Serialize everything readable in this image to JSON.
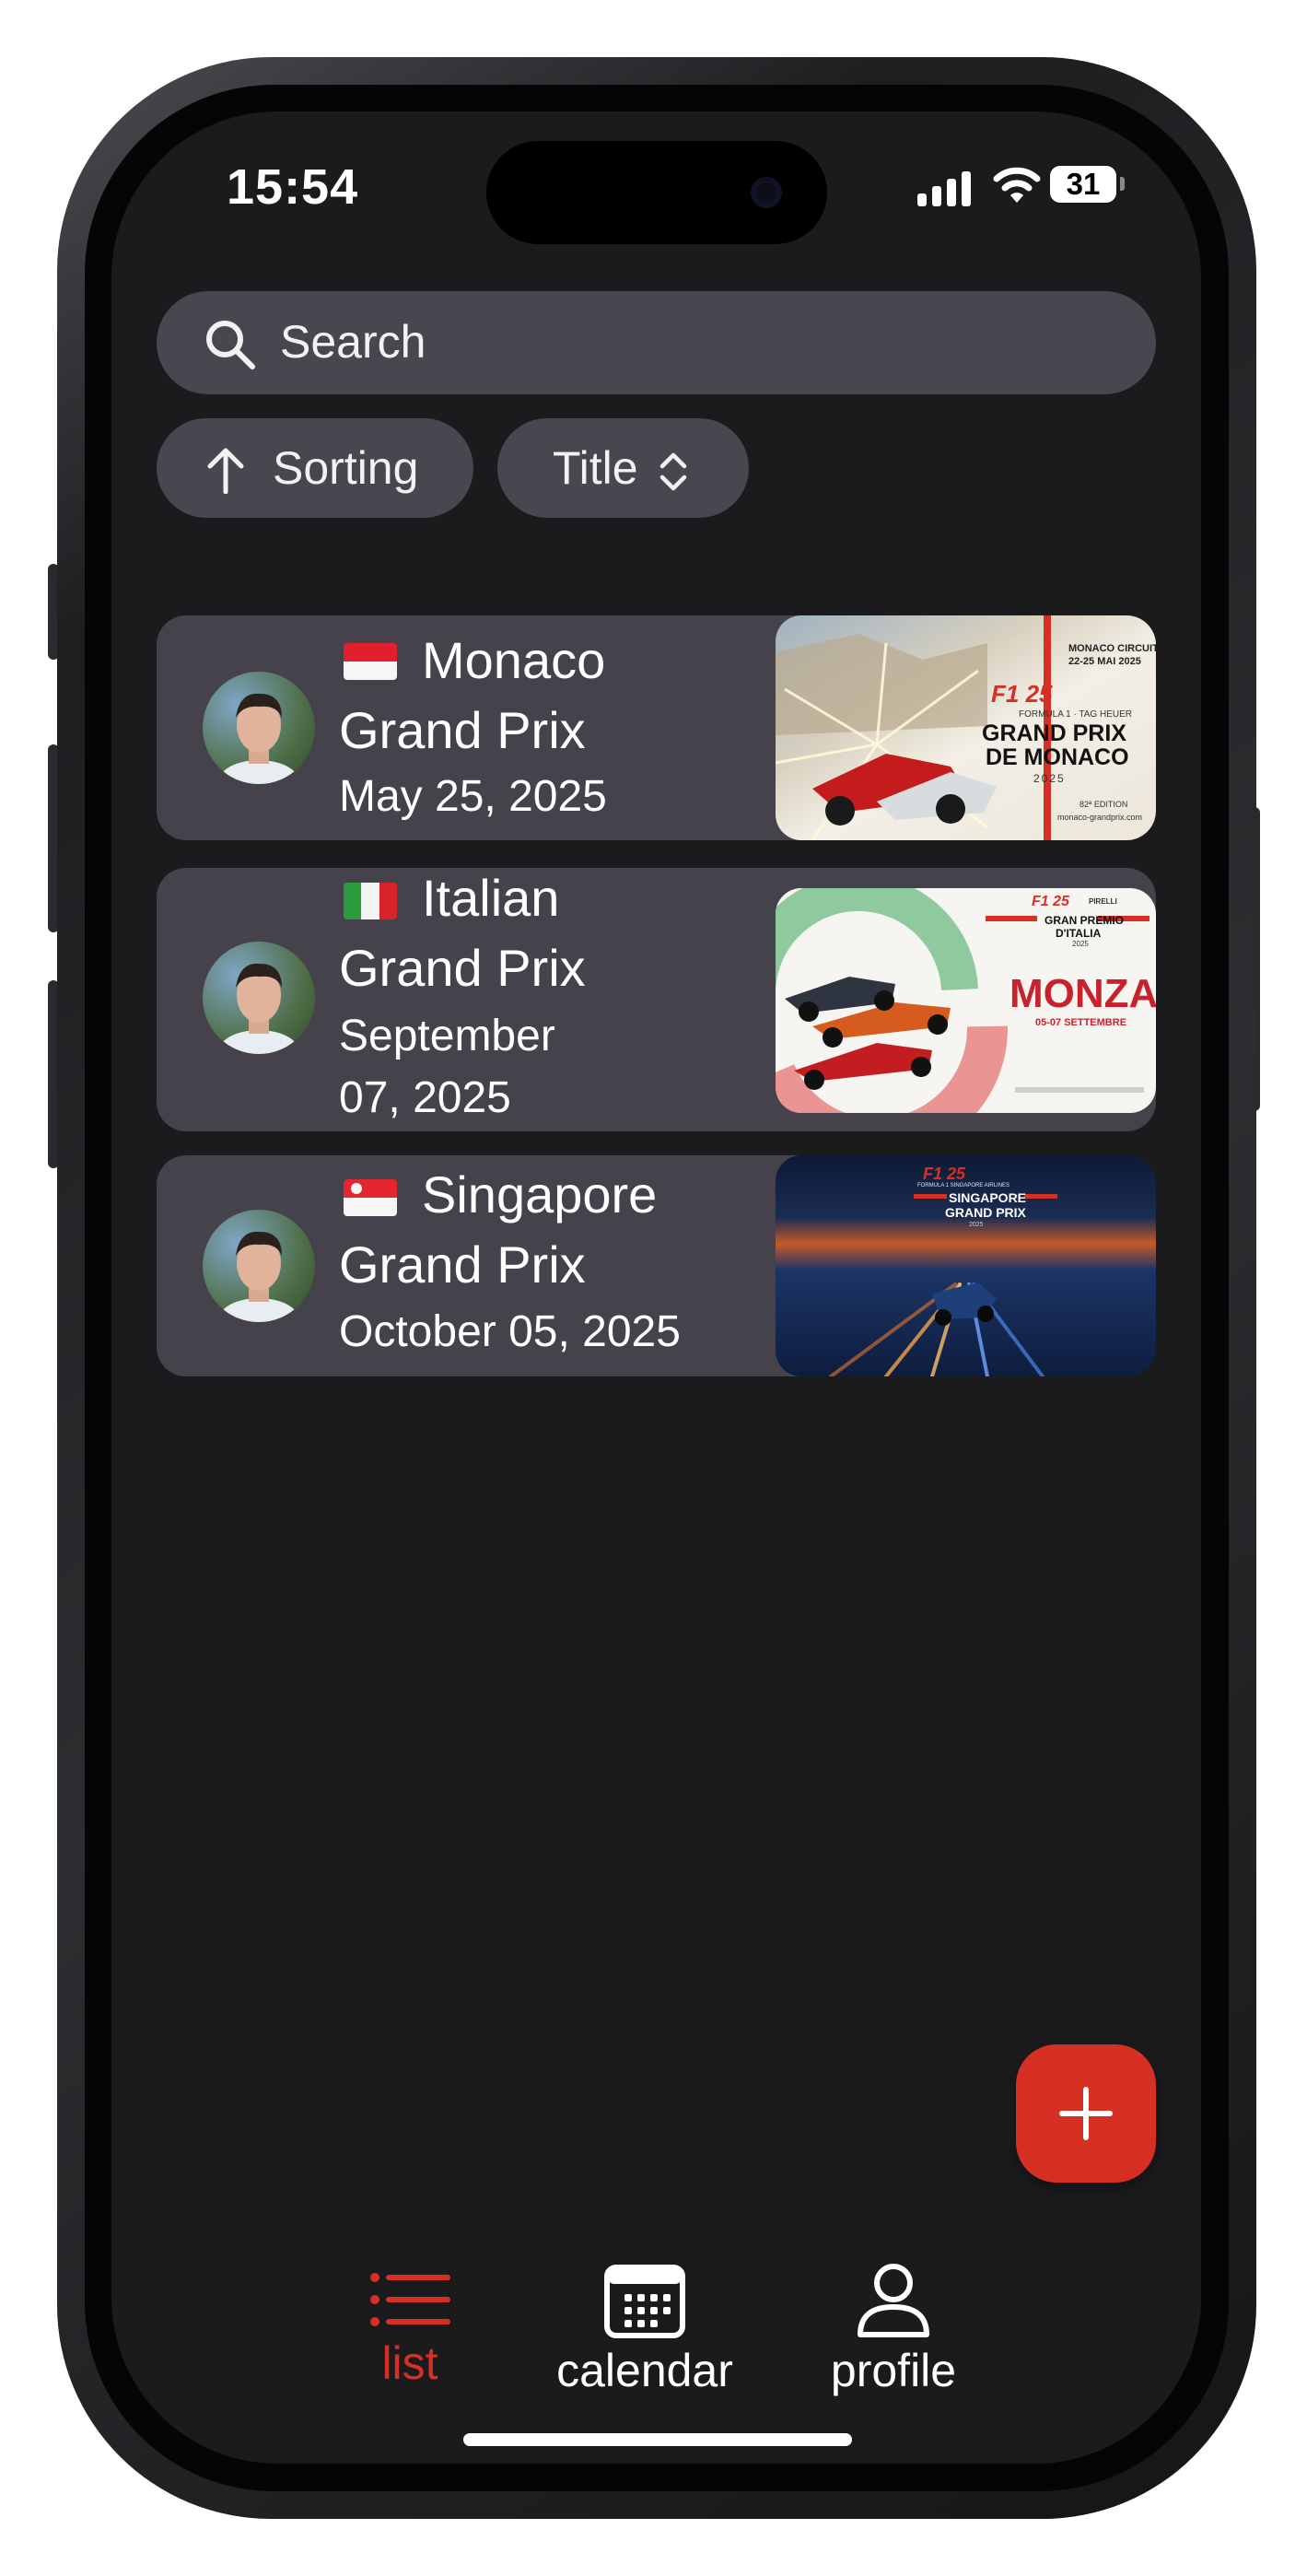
{
  "status_bar": {
    "time": "15:54",
    "battery_level": "31"
  },
  "search": {
    "placeholder": "Search"
  },
  "filters": {
    "sorting_label": "Sorting",
    "title_label": "Title"
  },
  "events": [
    {
      "flag": "Monaco",
      "title_line1": "Monaco",
      "title_line2": "Grand Prix",
      "date": "May 25, 2025",
      "poster": {
        "circuit": "MONACO CIRCUIT",
        "dates": "22-25 MAI 2025",
        "f1_year": "F1 25",
        "sponsor": "FORMULA 1 · TAG HEUER",
        "name_line1": "GRAND PRIX",
        "name_line2": "DE MONACO",
        "year": "2025",
        "edition": "82ª EDITION",
        "website": "monaco-grandprix.com"
      }
    },
    {
      "flag": "Italy",
      "title_line1": "Italian",
      "title_line2": "Grand Prix",
      "date_line1": "September",
      "date_line2": "07, 2025",
      "poster": {
        "f1_year": "F1 25",
        "sponsor": "PIRELLI",
        "name_line1": "GRAN PREMIO",
        "name_line2": "D'ITALIA",
        "year": "2025",
        "city": "MONZA",
        "dates": "05-07 SETTEMBRE"
      }
    },
    {
      "flag": "Singapore",
      "title_line1": "Singapore",
      "title_line2": "Grand Prix",
      "date": "October 05, 2025",
      "poster": {
        "f1_year": "F1 25",
        "sponsor": "FORMULA 1 SINGAPORE AIRLINES",
        "name_line1": "SINGAPORE",
        "name_line2": "GRAND PRIX",
        "year": "2025"
      }
    }
  ],
  "fab": {
    "icon": "plus-icon"
  },
  "tab_bar": {
    "tabs": [
      {
        "label": "list",
        "icon": "list-icon",
        "active": true
      },
      {
        "label": "calendar",
        "icon": "calendar-icon",
        "active": false
      },
      {
        "label": "profile",
        "icon": "person-icon",
        "active": false
      }
    ]
  },
  "colors": {
    "accent": "#d62f24",
    "background": "#1b1a1d",
    "card": "#45424b",
    "control": "#49464f"
  }
}
